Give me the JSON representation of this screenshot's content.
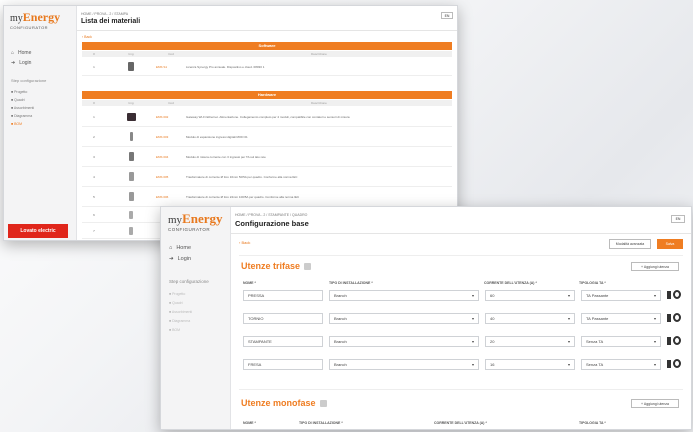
{
  "back_window": {
    "logo": {
      "my": "my",
      "energy": "Energy",
      "configurator": "CONFIGURATOR"
    },
    "nav": [
      {
        "label": "Home",
        "icon": "home-icon"
      },
      {
        "label": "Login",
        "icon": "login-icon"
      }
    ],
    "steps_title": "Step configurazione",
    "steps": [
      "Progetto",
      "Quadri",
      "Assorbimenti",
      "Diagramma",
      "BOM"
    ],
    "breadcrumb": "HOME / PROVA - 2 / STAMPA",
    "title": "Lista dei materiali",
    "lang": "EN",
    "back_link": "‹ Back",
    "software_header": "Software",
    "hardware_header": "Hardware",
    "col_headers": [
      "#",
      "Img",
      "Cod",
      "Descrizione"
    ],
    "software_rows": [
      {
        "n": "1",
        "code": "EMS S1",
        "desc": "Licenza Synergy Pro annuale. Dispositivo e cloud. 08030 1"
      }
    ],
    "hardware_rows": [
      {
        "n": "1",
        "code": "EMS 002",
        "desc": "Gateway Wi-Fi Ethernet. Alimentazione. Collegamento completo per 4 moduli, compatibile con contatori e sensori di misura"
      },
      {
        "n": "2",
        "code": "EMS 003",
        "desc": "Modulo di espansione ingressi digitali MOD 01"
      },
      {
        "n": "3",
        "code": "EMS 004",
        "desc": "Modulo di misura corrente con 3 ingressi per TA sul lato rete"
      },
      {
        "n": "4",
        "code": "EMS 005",
        "desc": "Trasformatore di corrente Ø foro 16mm 50/5A per quadro. Conforme alla norma IEC"
      },
      {
        "n": "5",
        "code": "EMS 006",
        "desc": "Trasformatore di corrente Ø foro 24mm 100/5A per quadro. Conforme alla norma IEC"
      },
      {
        "n": "6",
        "code": "",
        "desc": ""
      },
      {
        "n": "7",
        "code": "",
        "desc": ""
      }
    ],
    "brand": "Lovato electric"
  },
  "front_window": {
    "logo": {
      "my": "my",
      "energy": "Energy",
      "configurator": "CONFIGURATOR"
    },
    "nav": [
      {
        "label": "Home",
        "icon": "home-icon"
      },
      {
        "label": "Login",
        "icon": "login-icon"
      }
    ],
    "steps_title": "Step configurazione",
    "steps": [
      "Progetto",
      "Quadri",
      "Assorbimenti",
      "Diagramma",
      "BOM"
    ],
    "breadcrumb": "HOME / PROVA - 2 / STAMPANTE / QUADRO",
    "title": "Configurazione base",
    "lang": "EN",
    "back_link": "‹ Back",
    "btn_advanced": "Modalità avanzata",
    "btn_save": "Salva",
    "trifase": {
      "title": "Utenze trifase",
      "add_label": "+ Aggiungi utenza",
      "headers": [
        "NOME *",
        "TIPO DI INSTALLAZIONE *",
        "CORRENTE DELL'UTENZA (A) *",
        "TIPOLOGIA TA *"
      ],
      "rows": [
        {
          "name": "PRESSA",
          "tipo": "Branch",
          "corrente": "60",
          "ta": "TA Passante"
        },
        {
          "name": "TORNIO",
          "tipo": "Branch",
          "corrente": "40",
          "ta": "TA Passante"
        },
        {
          "name": "STAMPANTE",
          "tipo": "Branch",
          "corrente": "20",
          "ta": "Senza TA"
        },
        {
          "name": "FRESA",
          "tipo": "Branch",
          "corrente": "16",
          "ta": "Senza TA"
        }
      ]
    },
    "monofase": {
      "title": "Utenze monofase",
      "add_label": "+ Aggiungi utenza",
      "headers": [
        "NOME *",
        "TIPO DI INSTALLAZIONE *",
        "CORRENTE DELL'UTENZA (A) *",
        "TIPOLOGIA TA *"
      ]
    }
  }
}
